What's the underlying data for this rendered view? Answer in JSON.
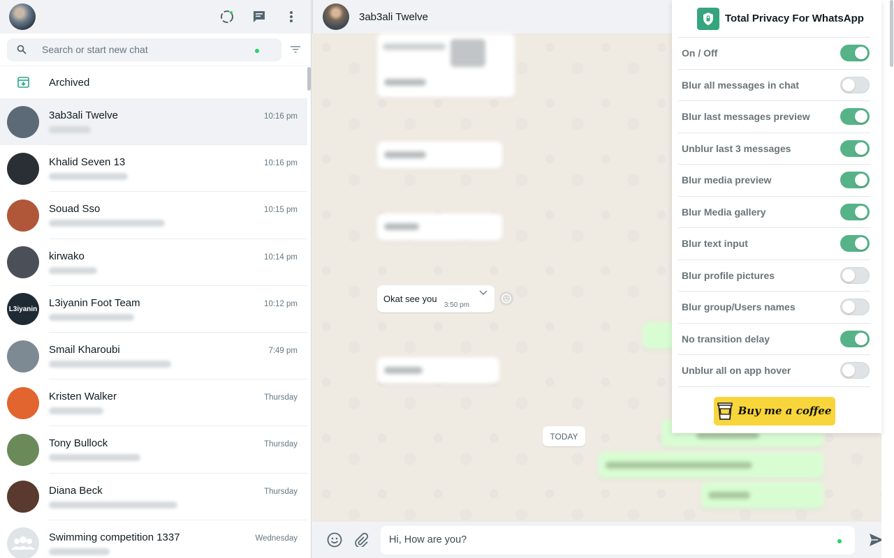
{
  "sidebar": {
    "search": {
      "placeholder": "Search or start new chat"
    },
    "archived_label": "Archived",
    "chats": [
      {
        "name": "3ab3ali Twelve",
        "time": "10:16 pm",
        "active": true,
        "avatar_color": "#5b6a76"
      },
      {
        "name": "Khalid Seven 13",
        "time": "10:16 pm",
        "active": false,
        "avatar_color": "#2a2f35"
      },
      {
        "name": "Souad Sso",
        "time": "10:15 pm",
        "active": false,
        "avatar_color": "#b0573a"
      },
      {
        "name": "kirwako",
        "time": "10:14 pm",
        "active": false,
        "avatar_color": "#4a4f58"
      },
      {
        "name": "L3iyanin Foot Team",
        "time": "10:12 pm",
        "active": false,
        "avatar_color": "#1e2a34",
        "avatar_text": "L3iyanin"
      },
      {
        "name": "Smail Kharoubi",
        "time": "7:49 pm",
        "active": false,
        "avatar_color": "#7d8a93"
      },
      {
        "name": "Kristen Walker",
        "time": "Thursday",
        "active": false,
        "avatar_color": "#e2642f"
      },
      {
        "name": "Tony Bullock",
        "time": "Thursday",
        "active": false,
        "avatar_color": "#6b8a5a"
      },
      {
        "name": "Diana Beck",
        "time": "Thursday",
        "active": false,
        "avatar_color": "#5a3a2e"
      },
      {
        "name": "Swimming competition 1337",
        "time": "Wednesday",
        "active": false,
        "avatar_color": "#dfe5e7"
      }
    ]
  },
  "conversation": {
    "contact_name": "3ab3ali Twelve",
    "visible_message": {
      "text": "Okat see you",
      "time": "3:50 pm"
    },
    "date_divider": "TODAY",
    "composer_text": "Hi, How are you?"
  },
  "privacy_panel": {
    "title": "Total Privacy For WhatsApp",
    "options": [
      {
        "label": "On / Off",
        "on": true
      },
      {
        "label": "Blur all messages in chat",
        "on": false
      },
      {
        "label": "Blur last messages preview",
        "on": true
      },
      {
        "label": "Unblur last 3 messages",
        "on": true
      },
      {
        "label": "Blur media preview",
        "on": true
      },
      {
        "label": "Blur Media gallery",
        "on": true
      },
      {
        "label": "Blur text input",
        "on": true
      },
      {
        "label": "Blur profile pictures",
        "on": false
      },
      {
        "label": "Blur group/Users names",
        "on": false
      },
      {
        "label": "No transition delay",
        "on": true
      },
      {
        "label": "Unblur all on app hover",
        "on": false
      }
    ],
    "coffee_label": "Buy me a coffee"
  },
  "colors": {
    "accent_green": "#56b388",
    "outgoing_bubble": "#d9fdd3",
    "coffee_yellow": "#f8d53a"
  }
}
